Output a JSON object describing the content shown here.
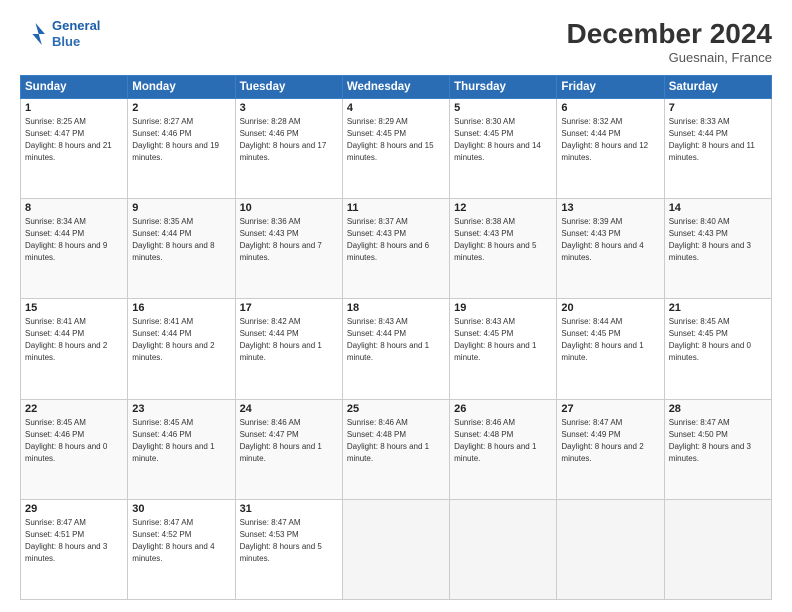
{
  "header": {
    "logo_line1": "General",
    "logo_line2": "Blue",
    "month_title": "December 2024",
    "location": "Guesnain, France"
  },
  "days_of_week": [
    "Sunday",
    "Monday",
    "Tuesday",
    "Wednesday",
    "Thursday",
    "Friday",
    "Saturday"
  ],
  "weeks": [
    [
      {
        "day": 1,
        "sunrise": "8:25 AM",
        "sunset": "4:47 PM",
        "daylight": "8 hours and 21 minutes."
      },
      {
        "day": 2,
        "sunrise": "8:27 AM",
        "sunset": "4:46 PM",
        "daylight": "8 hours and 19 minutes."
      },
      {
        "day": 3,
        "sunrise": "8:28 AM",
        "sunset": "4:46 PM",
        "daylight": "8 hours and 17 minutes."
      },
      {
        "day": 4,
        "sunrise": "8:29 AM",
        "sunset": "4:45 PM",
        "daylight": "8 hours and 15 minutes."
      },
      {
        "day": 5,
        "sunrise": "8:30 AM",
        "sunset": "4:45 PM",
        "daylight": "8 hours and 14 minutes."
      },
      {
        "day": 6,
        "sunrise": "8:32 AM",
        "sunset": "4:44 PM",
        "daylight": "8 hours and 12 minutes."
      },
      {
        "day": 7,
        "sunrise": "8:33 AM",
        "sunset": "4:44 PM",
        "daylight": "8 hours and 11 minutes."
      }
    ],
    [
      {
        "day": 8,
        "sunrise": "8:34 AM",
        "sunset": "4:44 PM",
        "daylight": "8 hours and 9 minutes."
      },
      {
        "day": 9,
        "sunrise": "8:35 AM",
        "sunset": "4:44 PM",
        "daylight": "8 hours and 8 minutes."
      },
      {
        "day": 10,
        "sunrise": "8:36 AM",
        "sunset": "4:43 PM",
        "daylight": "8 hours and 7 minutes."
      },
      {
        "day": 11,
        "sunrise": "8:37 AM",
        "sunset": "4:43 PM",
        "daylight": "8 hours and 6 minutes."
      },
      {
        "day": 12,
        "sunrise": "8:38 AM",
        "sunset": "4:43 PM",
        "daylight": "8 hours and 5 minutes."
      },
      {
        "day": 13,
        "sunrise": "8:39 AM",
        "sunset": "4:43 PM",
        "daylight": "8 hours and 4 minutes."
      },
      {
        "day": 14,
        "sunrise": "8:40 AM",
        "sunset": "4:43 PM",
        "daylight": "8 hours and 3 minutes."
      }
    ],
    [
      {
        "day": 15,
        "sunrise": "8:41 AM",
        "sunset": "4:44 PM",
        "daylight": "8 hours and 2 minutes."
      },
      {
        "day": 16,
        "sunrise": "8:41 AM",
        "sunset": "4:44 PM",
        "daylight": "8 hours and 2 minutes."
      },
      {
        "day": 17,
        "sunrise": "8:42 AM",
        "sunset": "4:44 PM",
        "daylight": "8 hours and 1 minute."
      },
      {
        "day": 18,
        "sunrise": "8:43 AM",
        "sunset": "4:44 PM",
        "daylight": "8 hours and 1 minute."
      },
      {
        "day": 19,
        "sunrise": "8:43 AM",
        "sunset": "4:45 PM",
        "daylight": "8 hours and 1 minute."
      },
      {
        "day": 20,
        "sunrise": "8:44 AM",
        "sunset": "4:45 PM",
        "daylight": "8 hours and 1 minute."
      },
      {
        "day": 21,
        "sunrise": "8:45 AM",
        "sunset": "4:45 PM",
        "daylight": "8 hours and 0 minutes."
      }
    ],
    [
      {
        "day": 22,
        "sunrise": "8:45 AM",
        "sunset": "4:46 PM",
        "daylight": "8 hours and 0 minutes."
      },
      {
        "day": 23,
        "sunrise": "8:45 AM",
        "sunset": "4:46 PM",
        "daylight": "8 hours and 1 minute."
      },
      {
        "day": 24,
        "sunrise": "8:46 AM",
        "sunset": "4:47 PM",
        "daylight": "8 hours and 1 minute."
      },
      {
        "day": 25,
        "sunrise": "8:46 AM",
        "sunset": "4:48 PM",
        "daylight": "8 hours and 1 minute."
      },
      {
        "day": 26,
        "sunrise": "8:46 AM",
        "sunset": "4:48 PM",
        "daylight": "8 hours and 1 minute."
      },
      {
        "day": 27,
        "sunrise": "8:47 AM",
        "sunset": "4:49 PM",
        "daylight": "8 hours and 2 minutes."
      },
      {
        "day": 28,
        "sunrise": "8:47 AM",
        "sunset": "4:50 PM",
        "daylight": "8 hours and 3 minutes."
      }
    ],
    [
      {
        "day": 29,
        "sunrise": "8:47 AM",
        "sunset": "4:51 PM",
        "daylight": "8 hours and 3 minutes."
      },
      {
        "day": 30,
        "sunrise": "8:47 AM",
        "sunset": "4:52 PM",
        "daylight": "8 hours and 4 minutes."
      },
      {
        "day": 31,
        "sunrise": "8:47 AM",
        "sunset": "4:53 PM",
        "daylight": "8 hours and 5 minutes."
      },
      null,
      null,
      null,
      null
    ]
  ]
}
